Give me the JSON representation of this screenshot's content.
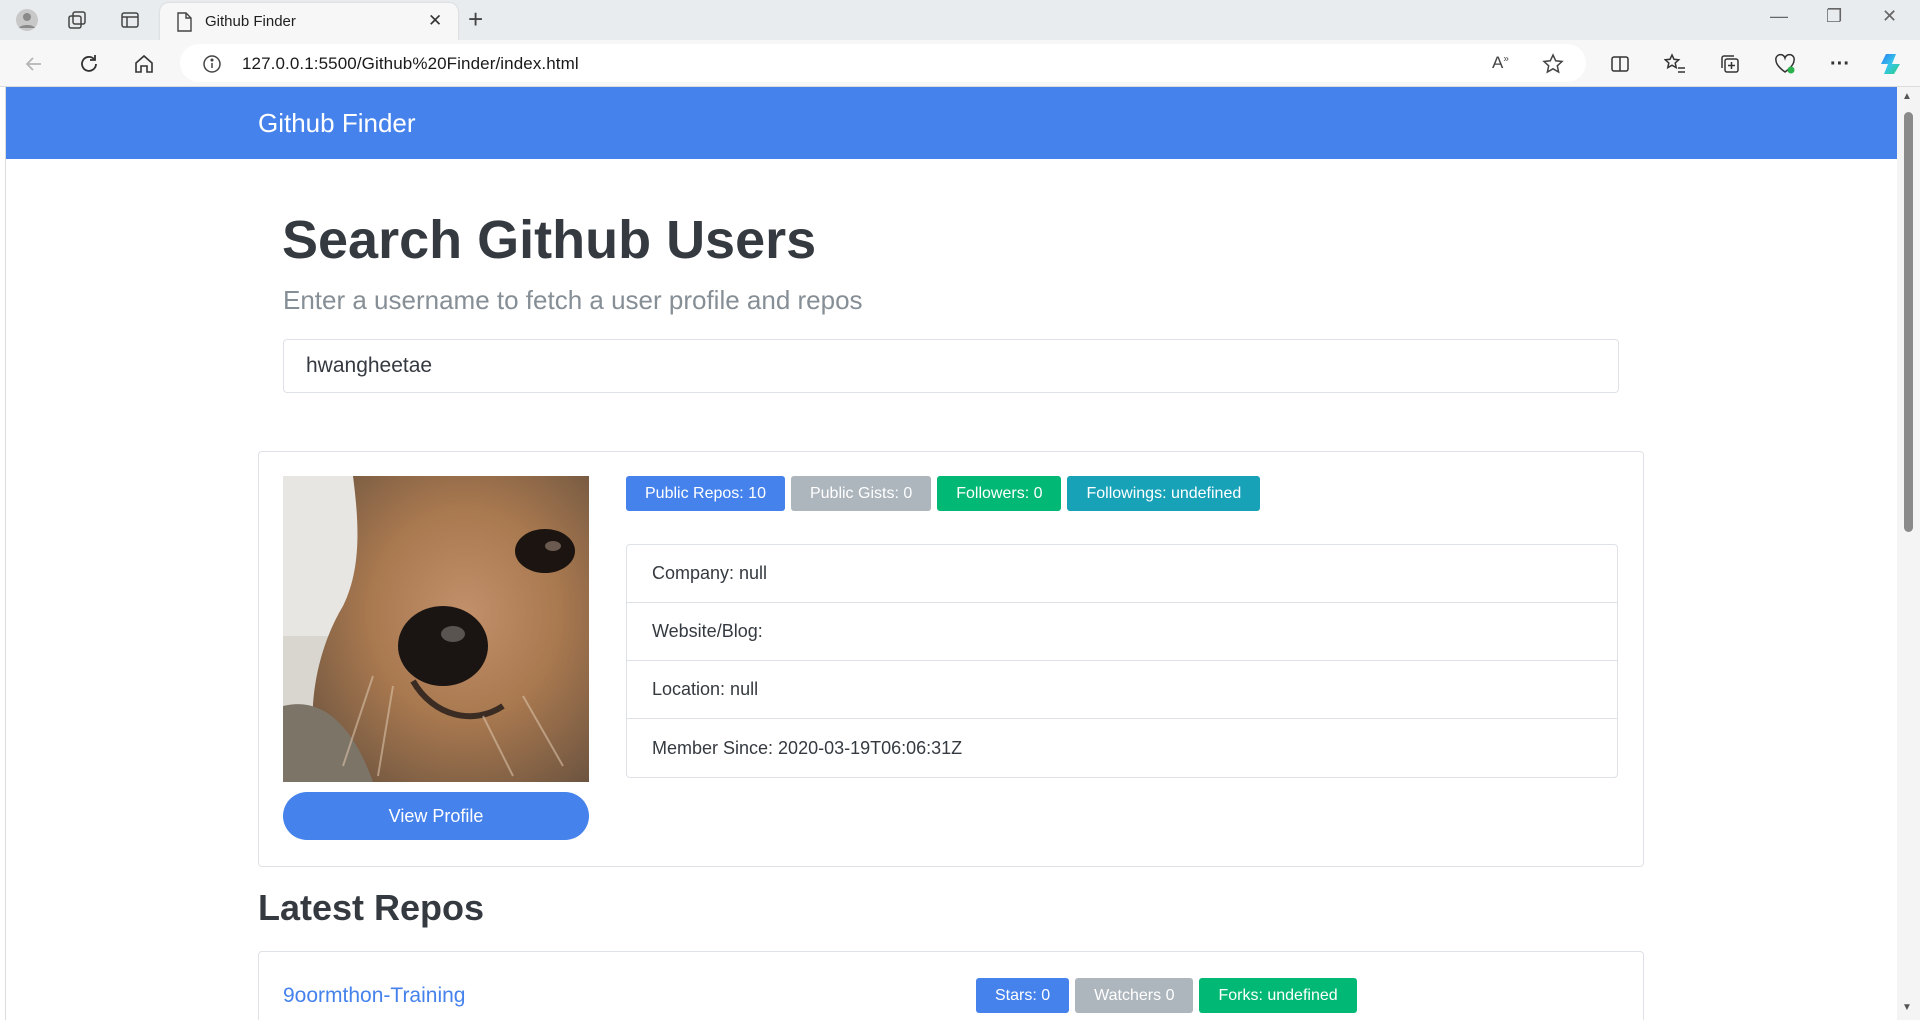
{
  "browser": {
    "tab_title": "Github Finder",
    "address": "127.0.0.1:5500/Github%20Finder/index.html"
  },
  "navbar": {
    "brand": "Github Finder"
  },
  "search": {
    "title": "Search Github Users",
    "lead": "Enter a username to fetch a user profile and repos",
    "value": "hwangheetae"
  },
  "profile": {
    "view_button": "View Profile",
    "badges": {
      "repos": "Public Repos: 10",
      "gists": "Public Gists: 0",
      "followers": "Followers: 0",
      "followings": "Followings: undefined"
    },
    "info": {
      "company": "Company: null",
      "website": "Website/Blog:",
      "location": "Location: null",
      "member_since": "Member Since: 2020-03-19T06:06:31Z"
    }
  },
  "repos": {
    "heading": "Latest Repos",
    "items": [
      {
        "name": "9oormthon-Training",
        "stars": "Stars: 0",
        "watchers": "Watchers 0",
        "forks": "Forks: undefined"
      }
    ]
  },
  "colors": {
    "primary": "#4582ec",
    "secondary": "#adb5bd",
    "success": "#02b875",
    "info": "#17a2b8"
  }
}
